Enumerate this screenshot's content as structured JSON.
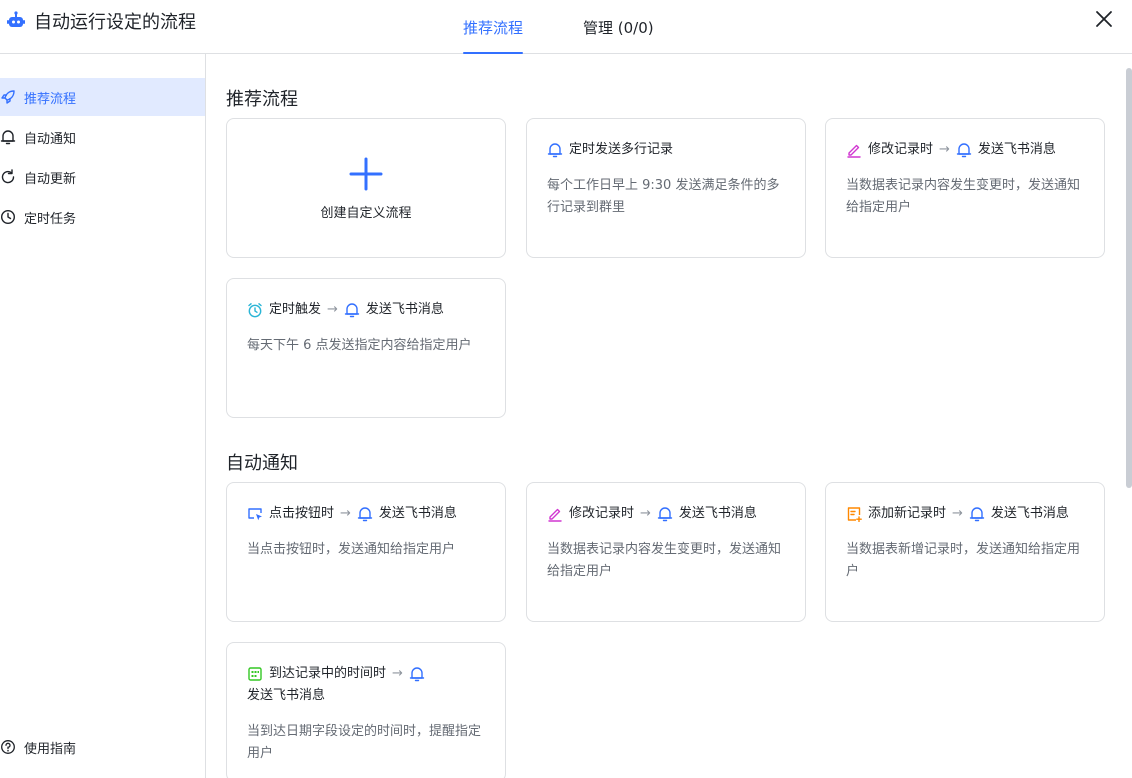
{
  "window": {
    "title": "自动运行设定的流程",
    "icon": "robot-icon",
    "close_icon": "close-icon"
  },
  "tabs": [
    {
      "label": "推荐流程",
      "active": true
    },
    {
      "label": "管理 (0/0)",
      "active": false
    }
  ],
  "sidebar": {
    "items": [
      {
        "label": "推荐流程",
        "icon": "rocket-icon",
        "active": true
      },
      {
        "label": "自动通知",
        "icon": "bell-icon",
        "active": false
      },
      {
        "label": "自动更新",
        "icon": "refresh-icon",
        "active": false
      },
      {
        "label": "定时任务",
        "icon": "clock-icon",
        "active": false
      }
    ],
    "guide": {
      "label": "使用指南",
      "icon": "help-icon"
    }
  },
  "sections": {
    "recommended": {
      "title": "推荐流程",
      "create_label": "创建自定义流程",
      "cards": [
        {
          "trigger": "定时发送多行记录",
          "trigger_icon": "bell-icon",
          "desc": "每个工作日早上 9:30 发送满足条件的多行记录到群里"
        },
        {
          "trigger": "修改记录时",
          "trigger_icon": "edit-icon",
          "arrow": "→",
          "action": "发送飞书消息",
          "action_icon": "bell-icon",
          "desc": "当数据表记录内容发生变更时，发送通知给指定用户"
        },
        {
          "trigger": "定时触发",
          "trigger_icon": "alarm-clock-icon",
          "arrow": "→",
          "action": "发送飞书消息",
          "action_icon": "bell-icon",
          "desc": "每天下午 6 点发送指定内容给指定用户"
        }
      ]
    },
    "notify": {
      "title": "自动通知",
      "cards": [
        {
          "trigger": "点击按钮时",
          "trigger_icon": "button-click-icon",
          "arrow": "→",
          "action": "发送飞书消息",
          "action_icon": "bell-icon",
          "desc": "当点击按钮时，发送通知给指定用户"
        },
        {
          "trigger": "修改记录时",
          "trigger_icon": "edit-icon",
          "arrow": "→",
          "action": "发送飞书消息",
          "action_icon": "bell-icon",
          "desc": "当数据表记录内容发生变更时，发送通知给指定用户"
        },
        {
          "trigger": "添加新记录时",
          "trigger_icon": "add-record-icon",
          "arrow": "→",
          "action": "发送飞书消息",
          "action_icon": "bell-icon",
          "desc": "当数据表新增记录时，发送通知给指定用户"
        },
        {
          "trigger": "到达记录中的时间时",
          "trigger_icon": "calendar-icon",
          "arrow": "→",
          "action": "发送飞书消息",
          "action_icon": "bell-icon",
          "desc": "当到达日期字段设定的时间时，提醒指定用户"
        }
      ]
    }
  },
  "colors": {
    "accent": "#3370ff",
    "edit_pink": "#d136d1",
    "orange": "#ff8800",
    "green": "#34c724",
    "cyan": "#2ab5d6"
  }
}
